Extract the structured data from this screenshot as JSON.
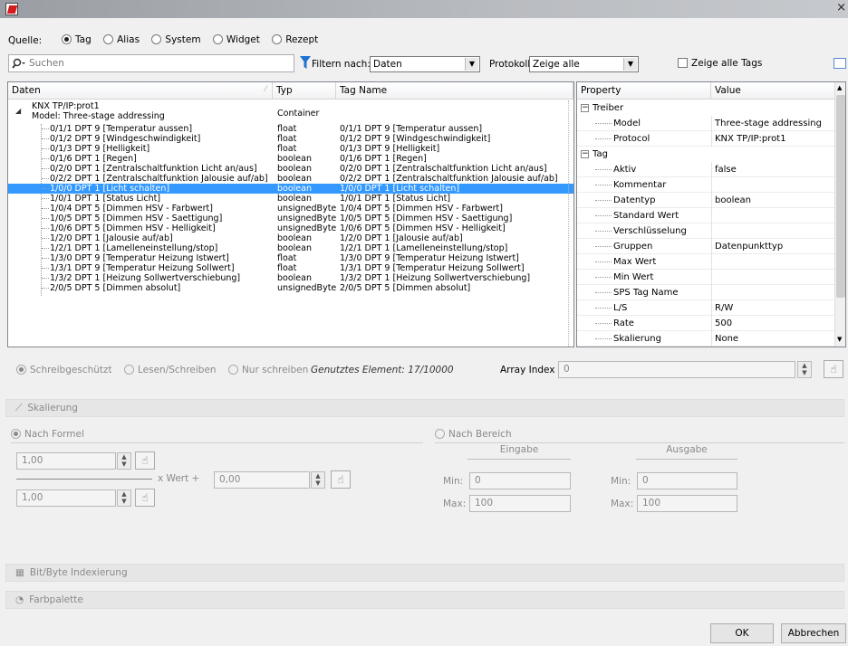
{
  "window": {
    "close_glyph": "×"
  },
  "source": {
    "label": "Quelle:",
    "options": [
      {
        "label": "Tag",
        "selected": true
      },
      {
        "label": "Alias",
        "selected": false
      },
      {
        "label": "System",
        "selected": false
      },
      {
        "label": "Widget",
        "selected": false
      },
      {
        "label": "Rezept",
        "selected": false
      }
    ]
  },
  "search": {
    "placeholder": "Suchen",
    "icon": "search-icon"
  },
  "filter": {
    "label": "Filtern nach:",
    "value": "Daten"
  },
  "protocol": {
    "label": "Protokoll:",
    "value": "Zeige alle"
  },
  "show_all_tags": {
    "label": "Zeige alle Tags",
    "checked": false
  },
  "table": {
    "columns": [
      "Daten",
      "Typ",
      "Tag Name"
    ],
    "root": {
      "line1": "KNX TP/IP:prot1",
      "line2": "Model: Three-stage addressing",
      "type": "Container"
    },
    "rows": [
      {
        "data": "0/1/1 DPT 9 [Temperatur aussen]",
        "type": "float",
        "tag": "0/1/1 DPT 9 [Temperatur aussen]"
      },
      {
        "data": "0/1/2 DPT 9 [Windgeschwindigkeit]",
        "type": "float",
        "tag": "0/1/2 DPT 9 [Windgeschwindigkeit]"
      },
      {
        "data": "0/1/3 DPT 9 [Helligkeit]",
        "type": "float",
        "tag": "0/1/3 DPT 9 [Helligkeit]"
      },
      {
        "data": "0/1/6 DPT 1 [Regen]",
        "type": "boolean",
        "tag": "0/1/6 DPT 1 [Regen]"
      },
      {
        "data": "0/2/0 DPT 1 [Zentralschaltfunktion Licht an/aus]",
        "type": "boolean",
        "tag": "0/2/0 DPT 1 [Zentralschaltfunktion Licht an/aus]"
      },
      {
        "data": "0/2/2 DPT 1 [Zentralschaltfunktion Jalousie auf/ab]",
        "type": "boolean",
        "tag": "0/2/2 DPT 1 [Zentralschaltfunktion Jalousie auf/ab]"
      },
      {
        "data": "1/0/0 DPT 1 [Licht schalten]",
        "type": "boolean",
        "tag": "1/0/0 DPT 1 [Licht schalten]",
        "selected": true
      },
      {
        "data": "1/0/1 DPT 1 [Status Licht]",
        "type": "boolean",
        "tag": "1/0/1 DPT 1 [Status Licht]"
      },
      {
        "data": "1/0/4 DPT 5 [Dimmen HSV - Farbwert]",
        "type": "unsignedByte",
        "tag": "1/0/4 DPT 5 [Dimmen HSV - Farbwert]"
      },
      {
        "data": "1/0/5 DPT 5 [Dimmen HSV - Saettigung]",
        "type": "unsignedByte",
        "tag": "1/0/5 DPT 5 [Dimmen HSV - Saettigung]"
      },
      {
        "data": "1/0/6 DPT 5 [Dimmen HSV - Helligkeit]",
        "type": "unsignedByte",
        "tag": "1/0/6 DPT 5 [Dimmen HSV - Helligkeit]"
      },
      {
        "data": "1/2/0 DPT 1 [Jalousie auf/ab]",
        "type": "boolean",
        "tag": "1/2/0 DPT 1 [Jalousie auf/ab]"
      },
      {
        "data": "1/2/1 DPT 1 [Lamelleneinstellung/stop]",
        "type": "boolean",
        "tag": "1/2/1 DPT 1 [Lamelleneinstellung/stop]"
      },
      {
        "data": "1/3/0 DPT 9 [Temperatur Heizung Istwert]",
        "type": "float",
        "tag": "1/3/0 DPT 9 [Temperatur Heizung Istwert]"
      },
      {
        "data": "1/3/1 DPT 9 [Temperatur Heizung Sollwert]",
        "type": "float",
        "tag": "1/3/1 DPT 9 [Temperatur Heizung Sollwert]"
      },
      {
        "data": "1/3/2 DPT 1 [Heizung Sollwertverschiebung]",
        "type": "boolean",
        "tag": "1/3/2 DPT 1 [Heizung Sollwertverschiebung]"
      },
      {
        "data": "2/0/5 DPT 5 [Dimmen absolut]",
        "type": "unsignedByte",
        "tag": "2/0/5 DPT 5 [Dimmen absolut]"
      }
    ]
  },
  "props": {
    "columns": [
      "Property",
      "Value"
    ],
    "groups": [
      {
        "name": "Treiber",
        "items": [
          {
            "name": "Model",
            "value": "Three-stage addressing"
          },
          {
            "name": "Protocol",
            "value": "KNX TP/IP:prot1"
          }
        ]
      },
      {
        "name": "Tag",
        "items": [
          {
            "name": "Aktiv",
            "value": "false"
          },
          {
            "name": "Kommentar",
            "value": ""
          },
          {
            "name": "Datentyp",
            "value": "boolean"
          },
          {
            "name": "Standard Wert",
            "value": ""
          },
          {
            "name": "Verschlüsselung",
            "value": ""
          },
          {
            "name": "Gruppen",
            "value": "Datenpunkttyp"
          },
          {
            "name": "Max Wert",
            "value": ""
          },
          {
            "name": "Min Wert",
            "value": ""
          },
          {
            "name": "SPS Tag Name",
            "value": ""
          },
          {
            "name": "L/S",
            "value": "R/W"
          },
          {
            "name": "Rate",
            "value": "500"
          },
          {
            "name": "Skalierung",
            "value": "None"
          }
        ]
      }
    ]
  },
  "access": {
    "options": [
      {
        "label": "Schreibgeschützt",
        "selected": true
      },
      {
        "label": "Lesen/Schreiben",
        "selected": false
      },
      {
        "label": "Nur schreiben",
        "selected": false
      }
    ],
    "used_label": "Genutztes Element:",
    "used_value": "17/10000",
    "array_label": "Array Index",
    "array_value": "0"
  },
  "scaling": {
    "title": "Skalierung",
    "formula_label": "Nach Formel",
    "formula_selected": true,
    "factor1": "1,00",
    "times_label": "x Wert +",
    "offset": "0,00",
    "factor2": "1,00",
    "range_label": "Nach Bereich",
    "input_label": "Eingabe",
    "output_label": "Ausgabe",
    "min_label": "Min:",
    "max_label": "Max:",
    "in_min": "0",
    "in_max": "100",
    "out_min": "0",
    "out_max": "100"
  },
  "sections": {
    "bitbyte": "Bit/Byte Indexierung",
    "palette": "Farbpalette"
  },
  "buttons": {
    "ok": "OK",
    "cancel": "Abbrechen"
  },
  "colors": {
    "selection": "#3399ff",
    "filter_icon": "#1e73d2"
  }
}
